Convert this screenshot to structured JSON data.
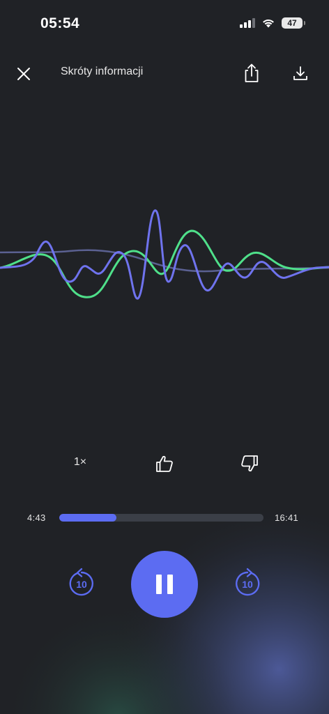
{
  "status_bar": {
    "time": "05:54",
    "battery": "47",
    "icons": [
      "signal-icon",
      "wifi-icon",
      "battery-icon"
    ]
  },
  "header": {
    "title": "Skróty informacji",
    "icons": [
      "close-icon",
      "share-icon",
      "download-icon"
    ]
  },
  "actions": {
    "speed": "1×",
    "icons": [
      "thumbs-up-icon",
      "thumbs-down-icon"
    ]
  },
  "player": {
    "current_time": "4:43",
    "total_time": "16:41",
    "progress_fraction": 0.28,
    "rewind_seconds": "10",
    "forward_seconds": "10",
    "state": "playing",
    "icons": [
      "rewind-10-icon",
      "pause-icon",
      "forward-10-icon"
    ]
  },
  "colors": {
    "background": "#202226",
    "accent": "#5c6cf2",
    "wave_green": "#4fe08a",
    "wave_blue": "#6f73ee",
    "wave_muted": "#5b6192"
  }
}
